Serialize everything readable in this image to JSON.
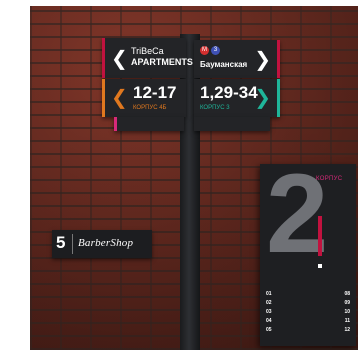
{
  "signs": {
    "tribeca": {
      "line1": "TriBeCa",
      "line2": "APARTMENTS",
      "arrow": "left-arrow"
    },
    "baumanskaya": {
      "metro_badges": [
        "М",
        "3"
      ],
      "label": "Бауманская",
      "arrow": "right-arrow"
    },
    "houses_left": {
      "numbers": "12-17",
      "sub": "КОРПУС 4Б",
      "arrow": "left-arrow",
      "accent": "#e0781f"
    },
    "houses_right": {
      "numbers": "1,29-34",
      "sub": "КОРПУС 3",
      "arrow": "right-arrow",
      "accent": "#1fb59a"
    }
  },
  "barbershop": {
    "number": "5",
    "name": "BarberShop"
  },
  "building_board": {
    "big_number": "2",
    "tag": "КОРПУС",
    "entries": [
      {
        "left": "01",
        "right": "08"
      },
      {
        "left": "02",
        "right": "09"
      },
      {
        "left": "03",
        "right": "10"
      },
      {
        "left": "04",
        "right": "11"
      },
      {
        "left": "05",
        "right": "12"
      }
    ]
  },
  "colors": {
    "brick": "#6e3024",
    "sign_bg": "#232427",
    "red_accent": "#c1123f",
    "orange_accent": "#e0781f",
    "teal_accent": "#1fb59a"
  }
}
